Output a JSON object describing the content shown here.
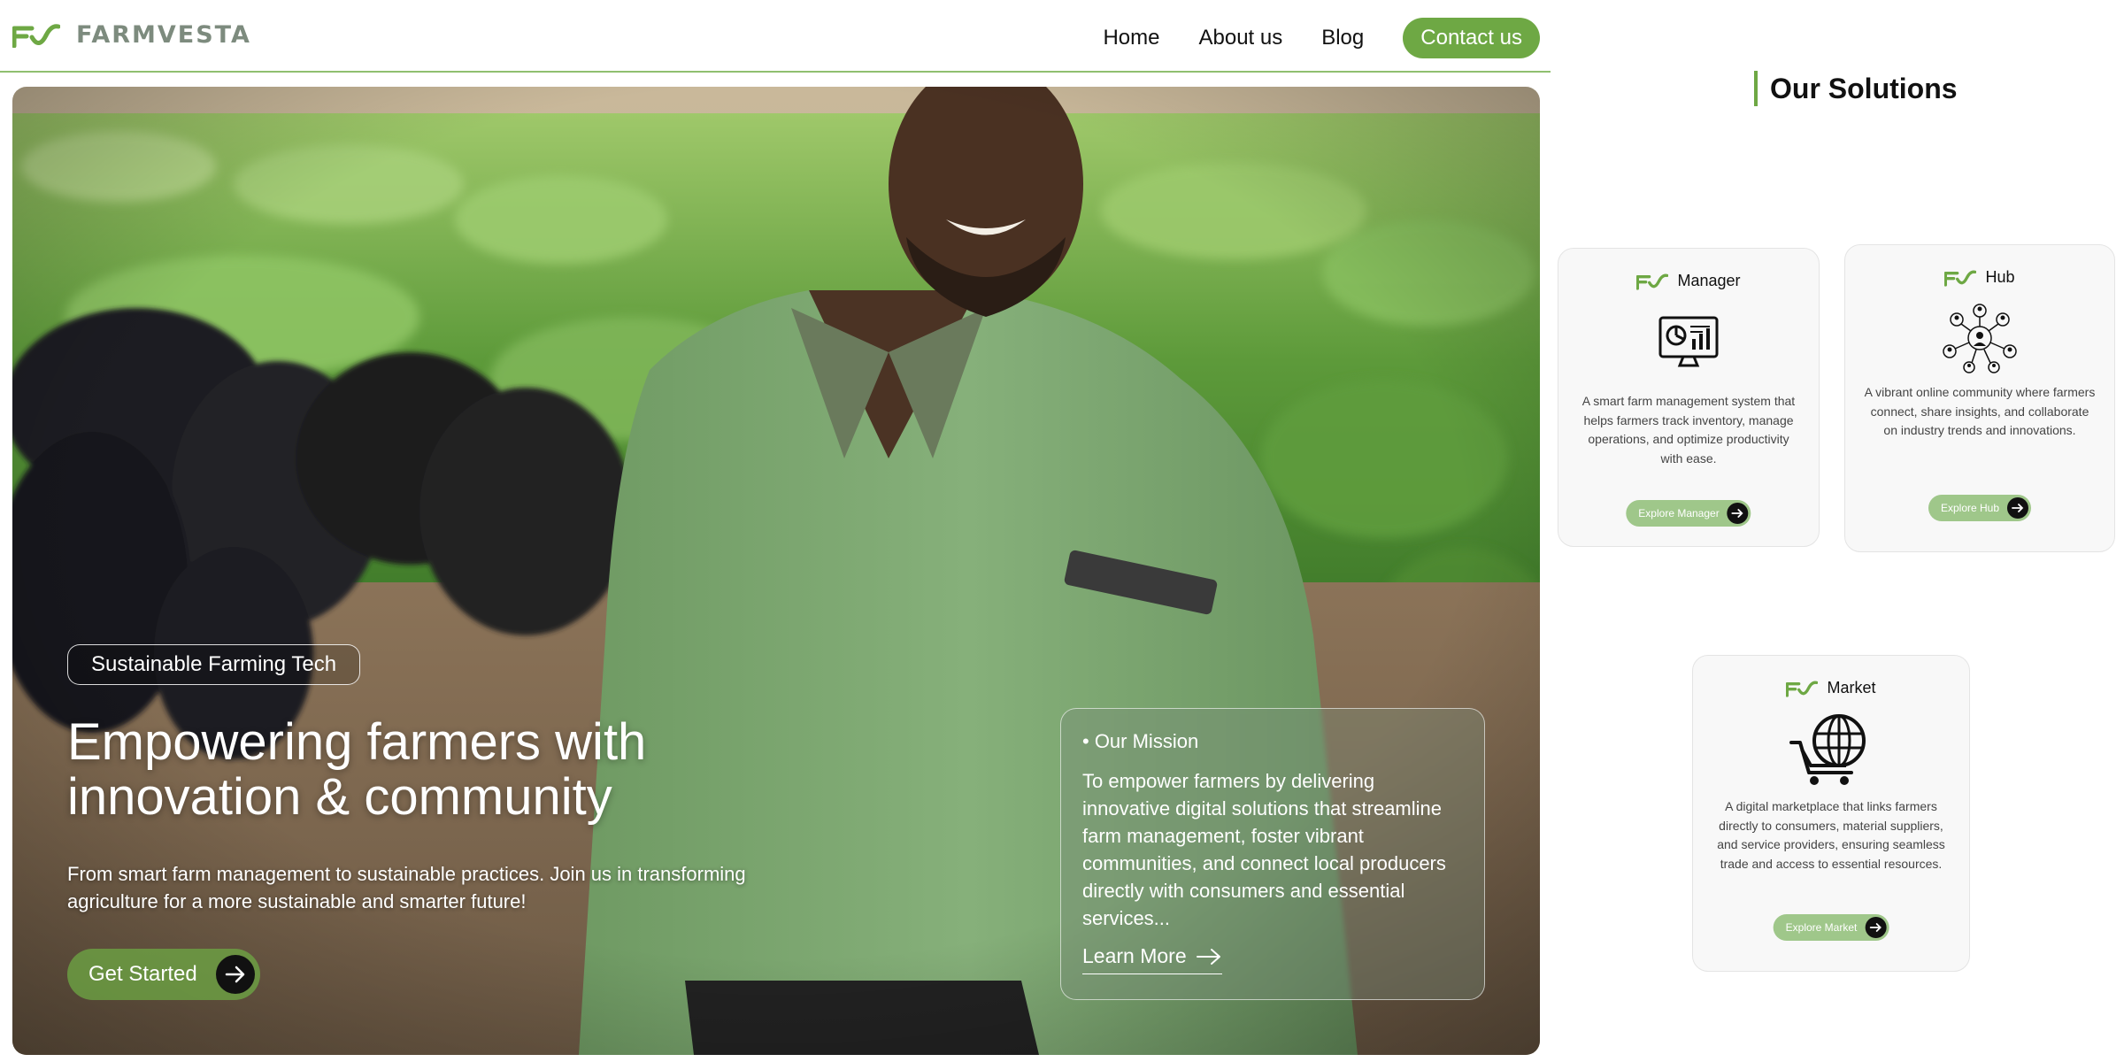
{
  "brand": {
    "name": "FARMVESTA",
    "accent": "#6ea844"
  },
  "nav": {
    "links": [
      "Home",
      "About us",
      "Blog"
    ],
    "contact_label": "Contact us"
  },
  "hero": {
    "tag": "Sustainable Farming Tech",
    "title_line1": "Empowering farmers with",
    "title_line2": "innovation & community",
    "subtitle": "From smart farm management to sustainable practices. Join us in transforming agriculture for a more sustainable and smarter future!",
    "cta_label": "Get Started",
    "cta_icon": "arrow-right-icon",
    "photo": "farmer-with-tablet-in-field-with-cattle"
  },
  "mission": {
    "title": "• Our Mission",
    "text": "To empower farmers by delivering innovative digital solutions that streamline farm management, foster vibrant communities, and connect local producers directly with consumers and essential services...",
    "link_label": "Learn More"
  },
  "solutions": {
    "title": "Our Solutions",
    "cards": [
      {
        "name": "Manager",
        "icon": "dashboard-monitor-icon",
        "description": "A smart farm management system that helps farmers track inventory, manage operations, and optimize productivity with ease.",
        "button_label": "Explore Manager"
      },
      {
        "name": "Hub",
        "icon": "community-network-icon",
        "description": "A vibrant online community where farmers connect, share insights, and collaborate on industry trends and innovations.",
        "button_label": "Explore Hub"
      },
      {
        "name": "Market",
        "icon": "globe-cart-icon",
        "description": "A digital marketplace that links farmers directly to consumers, material suppliers, and service providers, ensuring seamless trade and access to essential resources.",
        "button_label": "Explore Market"
      }
    ]
  }
}
